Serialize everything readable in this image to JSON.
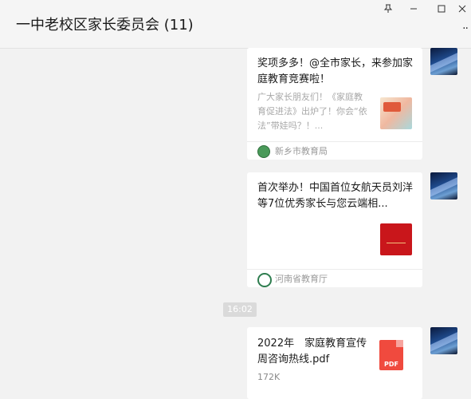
{
  "window": {
    "title": "一中老校区家长委员会 (11)",
    "buttons": {
      "pin_icon": "pin-icon",
      "minimize_icon": "minimize-icon",
      "maximize_icon": "maximize-icon",
      "close_icon": "close-icon"
    },
    "more_icon": "more-icon"
  },
  "messages": [
    {
      "type": "article",
      "title": "奖项多多！@全市家长，来参加家庭教育竞赛啦！",
      "description": "广大家长朋友们！《家庭教育促进法》出炉了！你会“依法”带娃吗？！...",
      "source": "新乡市教育局",
      "thumb_color": "#e9d9c3"
    },
    {
      "type": "article",
      "title": "首次举办！中国首位女航天员刘洋等7位优秀家长与您云端相...",
      "description": "",
      "source": "河南省教育厅",
      "thumb_color": "#c9161b"
    },
    {
      "type": "timestamp",
      "text": "16:02"
    },
    {
      "type": "file",
      "file_name": "2022年　家庭教育宣传周咨询热线.pdf",
      "file_size": "172K",
      "file_icon_label": "PDF",
      "file_icon_color": "#f04a3e"
    }
  ]
}
